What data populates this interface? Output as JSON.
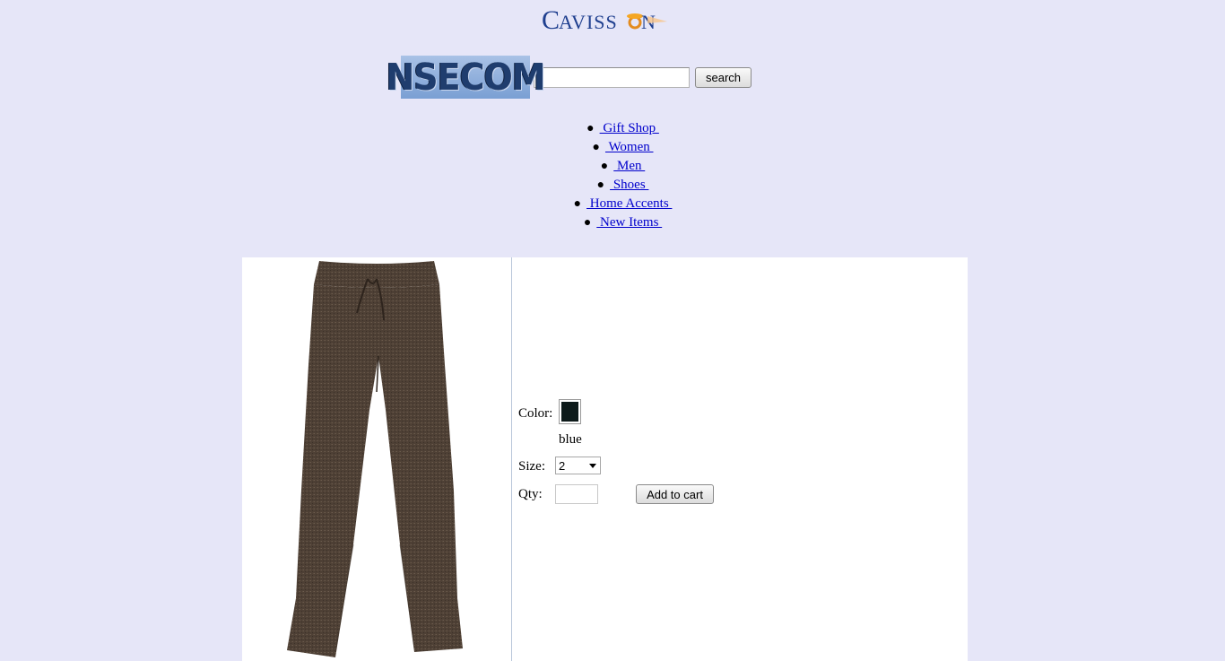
{
  "brand": {
    "logo_text": "Cavisson",
    "store_logo_text": "NSECOM"
  },
  "search": {
    "value": "",
    "button_label": "search"
  },
  "nav": {
    "items": [
      {
        "label": " Gift Shop "
      },
      {
        "label": " Women "
      },
      {
        "label": " Men "
      },
      {
        "label": " Shoes "
      },
      {
        "label": " Home Accents "
      },
      {
        "label": " New Items "
      }
    ]
  },
  "product": {
    "color_label": "Color:",
    "color_name": "blue",
    "swatch_color": "#0d1a1a",
    "size_label": "Size:",
    "size_value": "2",
    "qty_label": "Qty:",
    "qty_value": "",
    "add_to_cart_label": "Add to cart"
  },
  "colors": {
    "page_bg": "#e6e6f8",
    "link": "#0000cc",
    "panel_bg": "#ffffff"
  }
}
